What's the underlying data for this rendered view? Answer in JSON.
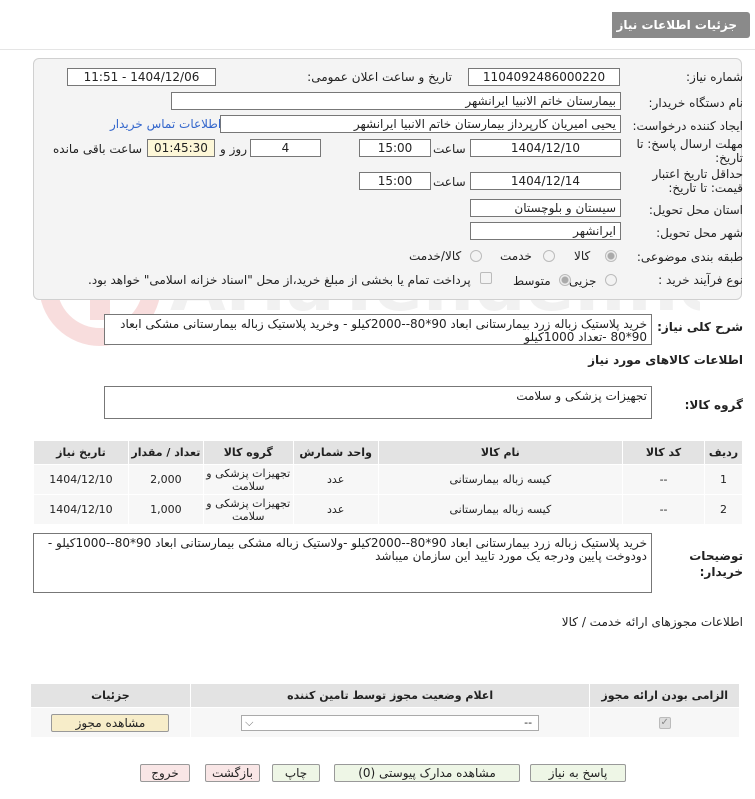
{
  "header": {
    "title": "جزئیات اطلاعات نیاز"
  },
  "form": {
    "need_number_label": "شماره نیاز:",
    "need_number": "1104092486000220",
    "announce_label": "تاریخ و ساعت اعلان عمومی:",
    "announce_value": "1404/12/06 - 11:51",
    "buyer_label": "نام دستگاه خریدار:",
    "buyer_value": "بیمارستان خاتم الانبیا ایرانشهر",
    "creator_label": "ایجاد کننده درخواست:",
    "creator_value": "یحیی امیریان کارپرداز بیمارستان خاتم الانبیا ایرانشهر",
    "contact_link": "اطلاعات تماس خریدار",
    "deadline_label": "مهلت ارسال پاسخ: تا تاریخ:",
    "deadline_date": "1404/12/10",
    "time_label": "ساعت",
    "deadline_time": "15:00",
    "days_value": "4",
    "days_label": "روز و",
    "remaining_time": "01:45:30",
    "remaining_label": "ساعت باقی مانده",
    "validity_label": "حداقل تاریخ اعتبار قیمت: تا تاریخ:",
    "validity_date": "1404/12/14",
    "validity_time": "15:00",
    "province_label": "استان محل تحویل:",
    "province_value": "سیستان و بلوچستان",
    "city_label": "شهر محل تحویل:",
    "city_value": "ایرانشهر",
    "category_label": "طبقه بندی موضوعی:",
    "category_options": [
      "کالا",
      "خدمت",
      "کالا/خدمت"
    ],
    "process_label": "نوع فرآیند خرید :",
    "process_options": [
      "جزیی",
      "متوسط"
    ],
    "payment_note": "پرداخت تمام یا بخشی از مبلغ خرید،از محل \"اسناد خزانه اسلامی\" خواهد بود."
  },
  "summary": {
    "label": "شرح کلی نیاز:",
    "text": "خرید پلاستیک زباله زرد بیمارستانی ابعاد 90*80--2000کیلو - وخرید پلاستیک  زباله بیمارستانی مشکی ابعاد 90*80 -تعداد 1000کیلو"
  },
  "goods": {
    "section_title": "اطلاعات کالاهای مورد نیاز",
    "group_label": "گروه کالا:",
    "group_value": "تجهیزات پزشکی و سلامت",
    "columns": [
      "ردیف",
      "کد کالا",
      "نام کالا",
      "واحد شمارش",
      "گروه کالا",
      "تعداد / مقدار",
      "تاریخ نیاز"
    ],
    "rows": [
      {
        "idx": "1",
        "code": "--",
        "name": "کیسه زباله بیمارستانی",
        "unit": "عدد",
        "group": "تجهیزات پزشکی و سلامت",
        "qty": "2,000",
        "date": "1404/12/10"
      },
      {
        "idx": "2",
        "code": "--",
        "name": "کیسه زباله بیمارستانی",
        "unit": "عدد",
        "group": "تجهیزات پزشکی و سلامت",
        "qty": "1,000",
        "date": "1404/12/10"
      }
    ]
  },
  "buyer_notes": {
    "label": "توضیحات خریدار:",
    "text": "خرید پلاستیک زباله زرد بیمارستانی ابعاد 90*80--2000کیلو -ولاستیک زباله مشکی  بیمارستانی ابعاد 90*80--1000کیلو - دودوخت پایین ودرجه یک مورد تایید این سازمان میباشد"
  },
  "permits": {
    "section_title": "اطلاعات مجوزهای ارائه خدمت / کالا",
    "columns": [
      "الزامی بودن ارائه مجوز",
      "اعلام وضعیت مجوز توسط تامین کننده",
      "جزئیات"
    ],
    "select_value": "--",
    "view_button": "مشاهده مجوز"
  },
  "buttons": {
    "reply": "پاسخ به نیاز",
    "attachments": "مشاهده مدارک پیوستی (0)",
    "print": "چاپ",
    "back": "بازگشت",
    "exit": "خروج"
  },
  "watermark": "AriaTender.neT"
}
